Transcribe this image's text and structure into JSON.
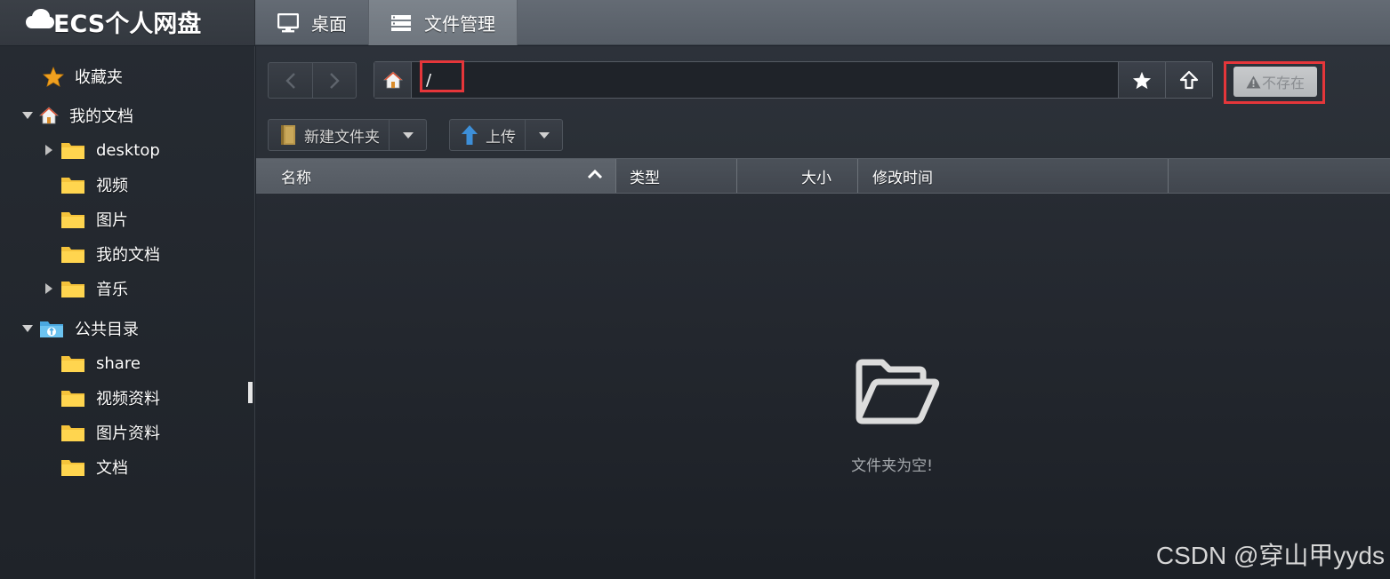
{
  "app": {
    "title": "ECS个人网盘",
    "logo_icon": "cloud-icon"
  },
  "topnav": {
    "tabs": [
      {
        "label": "桌面",
        "icon": "monitor-icon",
        "active": false
      },
      {
        "label": "文件管理",
        "icon": "server-icon",
        "active": true
      }
    ]
  },
  "sidebar": {
    "favorites_label": "收藏夹",
    "my_docs_label": "我的文档",
    "my_docs_children": [
      "desktop",
      "视频",
      "图片",
      "我的文档",
      "音乐"
    ],
    "public_label": "公共目录",
    "public_children": [
      "share",
      "视频资料",
      "图片资料",
      "文档"
    ]
  },
  "toolbar": {
    "path_value": "/",
    "status_label": "不存在",
    "new_folder_label": "新建文件夹",
    "upload_label": "上传"
  },
  "table": {
    "columns": [
      "名称",
      "类型",
      "大小",
      "修改时间"
    ]
  },
  "empty": {
    "message": "文件夹为空!",
    "icon": "folder-open-icon"
  },
  "watermark": "CSDN @穿山甲yyds",
  "colors": {
    "highlight_red": "#e5363a",
    "folder_yellow": "#f5c33b",
    "star_orange": "#f0a020"
  }
}
